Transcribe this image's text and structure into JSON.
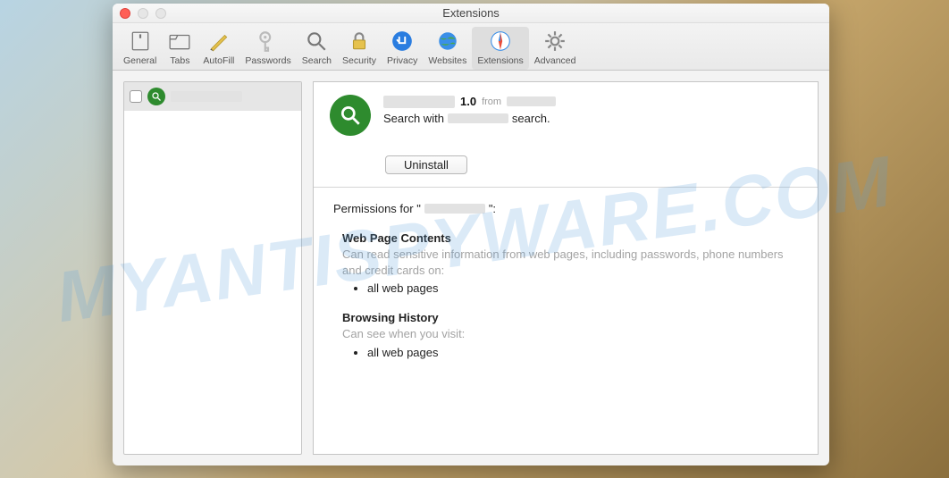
{
  "window": {
    "title": "Extensions"
  },
  "toolbar": {
    "items": [
      {
        "key": "general",
        "label": "General"
      },
      {
        "key": "tabs",
        "label": "Tabs"
      },
      {
        "key": "autofill",
        "label": "AutoFill"
      },
      {
        "key": "passwords",
        "label": "Passwords"
      },
      {
        "key": "search",
        "label": "Search"
      },
      {
        "key": "security",
        "label": "Security"
      },
      {
        "key": "privacy",
        "label": "Privacy"
      },
      {
        "key": "websites",
        "label": "Websites"
      },
      {
        "key": "extensions",
        "label": "Extensions"
      },
      {
        "key": "advanced",
        "label": "Advanced"
      }
    ]
  },
  "detail": {
    "version": "1.0",
    "from": "from",
    "description_prefix": "Search with",
    "description_suffix": "search.",
    "uninstall_label": "Uninstall"
  },
  "permissions": {
    "heading_prefix": "Permissions for \"",
    "heading_suffix": "\":",
    "sections": [
      {
        "title": "Web Page Contents",
        "desc": "Can read sensitive information from web pages, including passwords, phone numbers and credit cards on:",
        "item": "all web pages"
      },
      {
        "title": "Browsing History",
        "desc": "Can see when you visit:",
        "item": "all web pages"
      }
    ]
  },
  "watermark": "MYANTISPYWARE.COM"
}
